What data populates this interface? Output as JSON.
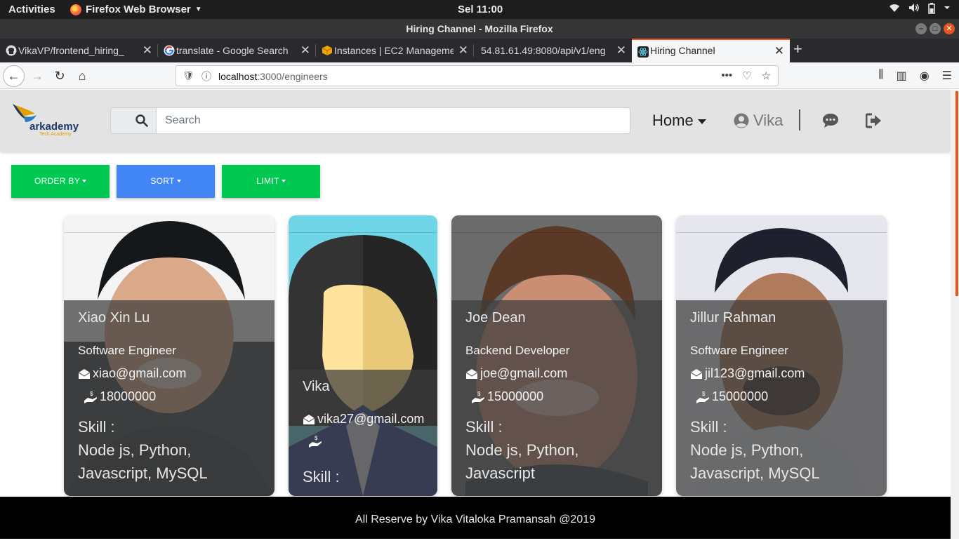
{
  "system": {
    "activities": "Activities",
    "app_menu": "Firefox Web Browser",
    "clock": "Sel 11:00"
  },
  "window": {
    "title": "Hiring Channel - Mozilla Firefox"
  },
  "tabs": [
    {
      "label": "VikaVP/frontend_hiring_",
      "icon": "github-icon"
    },
    {
      "label": "translate - Google Search",
      "icon": "google-icon"
    },
    {
      "label": "Instances | EC2 Management",
      "icon": "aws-icon"
    },
    {
      "label": "54.81.61.49:8080/api/v1/eng",
      "icon": ""
    },
    {
      "label": "Hiring Channel",
      "icon": "react-icon",
      "active": true
    }
  ],
  "address": {
    "host": "localhost",
    "rest": ":3000/engineers"
  },
  "header": {
    "brand": "arkademy",
    "brand_sub": "Tech Academy",
    "search_placeholder": "Search",
    "home_label": "Home",
    "user_name": "Vika"
  },
  "filters": {
    "order_by": "ORDER BY",
    "sort": "SORT",
    "limit": "LIMIT"
  },
  "engineers": [
    {
      "name": "Xiao Xin Lu",
      "role": "Software Engineer",
      "email": "xiao@gmail.com",
      "salary": "18000000",
      "skill_label": "Skill :",
      "skills": "Node js, Python, Javascript, MySQL"
    },
    {
      "name": "Vika",
      "role": "",
      "email": "vika27@gmail.com",
      "salary": "",
      "skill_label": "Skill :",
      "skills": ""
    },
    {
      "name": "Joe Dean",
      "role": "Backend Developer",
      "email": "joe@gmail.com",
      "salary": "15000000",
      "skill_label": "Skill :",
      "skills": "Node js, Python, Javascript"
    },
    {
      "name": "Jillur Rahman",
      "role": "Software Engineer",
      "email": "jil123@gmail.com",
      "salary": "15000000",
      "skill_label": "Skill :",
      "skills": "Node js, Python, Javascript, MySQL"
    }
  ],
  "footer": {
    "text": "All Reserve by Vika Vitaloka Pramansah @2019"
  },
  "colors": {
    "green": "#00c851",
    "blue": "#4285f4",
    "accent": "#e95420"
  }
}
